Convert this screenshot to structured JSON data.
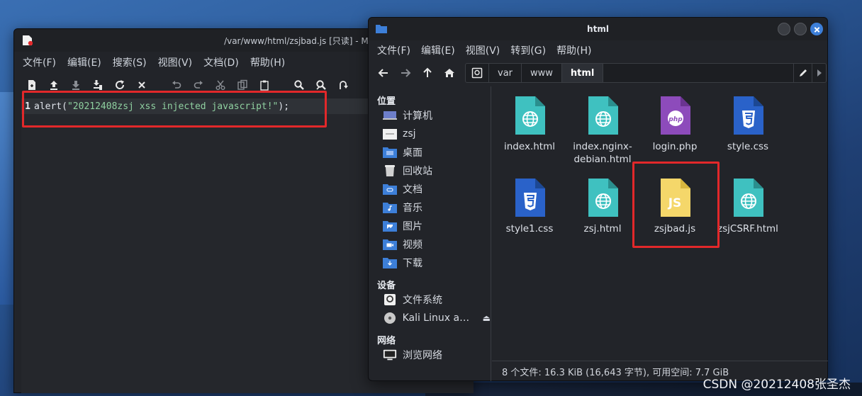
{
  "mousepad": {
    "title": "/var/www/html/zsjbad.js [只读] - Mousepad",
    "menu": [
      "文件(F)",
      "编辑(E)",
      "搜索(S)",
      "视图(V)",
      "文档(D)",
      "帮助(H)"
    ],
    "line_number": "1",
    "code_prefix": "alert(",
    "code_string": "\"20212408zsj xss injected javascript!\"",
    "code_suffix": ");"
  },
  "thunar": {
    "title": "html",
    "menu": [
      "文件(F)",
      "编辑(E)",
      "视图(V)",
      "转到(G)",
      "帮助(H)"
    ],
    "path": [
      "var",
      "www",
      "html"
    ],
    "sidebar": {
      "places_heading": "位置",
      "places": [
        "计算机",
        "zsj",
        "桌面",
        "回收站",
        "文档",
        "音乐",
        "图片",
        "视频",
        "下载"
      ],
      "devices_heading": "设备",
      "devices": [
        "文件系统",
        "Kali Linux am..."
      ],
      "network_heading": "网络",
      "network": [
        "浏览网络"
      ]
    },
    "files": [
      {
        "name": "index.html",
        "type": "html"
      },
      {
        "name": "index.nginx-debian.html",
        "type": "html"
      },
      {
        "name": "login.php",
        "type": "php"
      },
      {
        "name": "style.css",
        "type": "css"
      },
      {
        "name": "style1.css",
        "type": "css"
      },
      {
        "name": "zsj.html",
        "type": "html"
      },
      {
        "name": "zsjbad.js",
        "type": "js"
      },
      {
        "name": "zsjCSRF.html",
        "type": "html"
      }
    ],
    "status": "8 个文件: 16.3 KiB (16,643 字节), 可用空间: 7.7 GiB"
  },
  "watermark": "CSDN @20212408张圣杰",
  "colors": {
    "highlight": "#e2282a",
    "html_icon": "#3fc1c0",
    "php_icon": "#8d4bbb",
    "css_icon": "#2a62c9",
    "js_icon": "#f5d76a",
    "accent": "#3d7fd8"
  }
}
